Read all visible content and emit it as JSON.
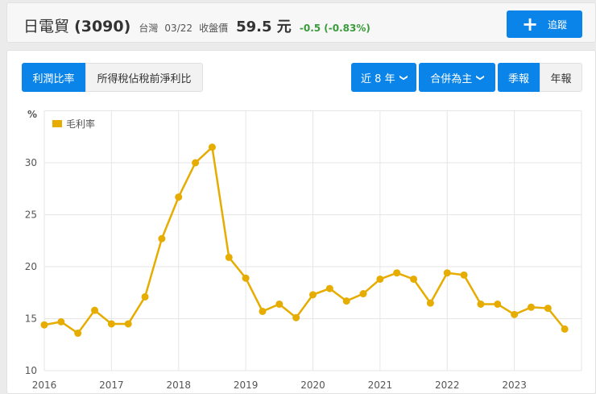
{
  "header": {
    "name": "日電貿",
    "code": "(3090)",
    "market": "台灣",
    "date": "03/22",
    "price_label": "收盤價",
    "price": "59.5 元",
    "change": "-0.5 (-0.83%)",
    "track_label": "追蹤",
    "track_icon": "plus-icon"
  },
  "toolbar": {
    "tabs": [
      "利潤比率",
      "所得稅佔稅前淨利比"
    ],
    "active_tab": 0,
    "range": "近 8 年",
    "consolidation": "合併為主",
    "period_tabs": [
      "季報",
      "年報"
    ],
    "active_period": 0
  },
  "colors": {
    "accent": "#0a84e8",
    "series": "#e6ac00",
    "positive_change": "#3a9b3a"
  },
  "chart_data": {
    "type": "line",
    "ylabel": "%",
    "ylim": [
      10,
      35
    ],
    "yticks": [
      10,
      15,
      20,
      25,
      30
    ],
    "xlim": [
      2016,
      2024
    ],
    "xticks": [
      "2016",
      "2017",
      "2018",
      "2019",
      "2020",
      "2021",
      "2022",
      "2023"
    ],
    "legend": "top-left",
    "grid": true,
    "series": [
      {
        "name": "毛利率",
        "color": "#e6ac00",
        "x": [
          "2016Q1",
          "2016Q2",
          "2016Q3",
          "2016Q4",
          "2017Q1",
          "2017Q2",
          "2017Q3",
          "2017Q4",
          "2018Q1",
          "2018Q2",
          "2018Q3",
          "2018Q4",
          "2019Q1",
          "2019Q2",
          "2019Q3",
          "2019Q4",
          "2020Q1",
          "2020Q2",
          "2020Q3",
          "2020Q4",
          "2021Q1",
          "2021Q2",
          "2021Q3",
          "2021Q4",
          "2022Q1",
          "2022Q2",
          "2022Q3",
          "2022Q4",
          "2023Q1",
          "2023Q2",
          "2023Q3",
          "2023Q4"
        ],
        "values": [
          14.4,
          14.7,
          13.6,
          15.8,
          14.5,
          14.5,
          17.1,
          22.7,
          26.7,
          30.0,
          31.5,
          20.9,
          18.9,
          15.7,
          16.4,
          15.1,
          17.3,
          17.9,
          16.7,
          17.4,
          18.8,
          19.4,
          18.8,
          16.5,
          19.4,
          19.2,
          16.4,
          16.4,
          15.4,
          16.1,
          16.0,
          14.0
        ]
      }
    ]
  }
}
